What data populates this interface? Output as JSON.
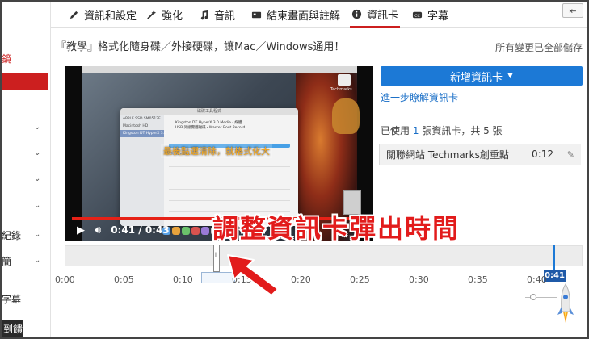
{
  "sidebar": {
    "fragments": [
      {
        "text": "鏡",
        "red": true
      },
      {
        "text": "紀錄",
        "red": false
      },
      {
        "text": "簡",
        "red": false
      },
      {
        "text": "字幕",
        "red": false
      },
      {
        "text": "到饋",
        "red": false
      }
    ]
  },
  "tabs": [
    {
      "label": "資訊和設定",
      "icon": "pencil-icon"
    },
    {
      "label": "強化",
      "icon": "magic-wand-icon"
    },
    {
      "label": "音訊",
      "icon": "music-note-icon"
    },
    {
      "label": "結束畫面與註解",
      "icon": "end-screen-icon"
    },
    {
      "label": "資訊卡",
      "icon": "info-icon",
      "active": true
    },
    {
      "label": "字幕",
      "icon": "cc-icon"
    }
  ],
  "back_button": "⇤",
  "video": {
    "title": "『教學』格式化隨身碟／外接硬碟，讓Mac／Windows通用！",
    "save_status": "所有變更已全部儲存",
    "current_time": "0:41",
    "duration": "0:43",
    "progress": 0.95,
    "caption": "最後點選清除，就格式化大",
    "watermark": "Techmarks",
    "window_title": "磁碟工具程式",
    "window_sidebar": [
      "APPLE SSD SM0512F",
      "Macintosh HD",
      "Kingston DT HyperX 3.0"
    ],
    "window_info": [
      "USB 外接實體磁碟・Master Boot Record",
      "Kingston DT HyperX 3.0 Media - 媒體"
    ],
    "window_volume_name": "Techmarks"
  },
  "cards": {
    "add_button": "新增資訊卡",
    "learn_more": "進一步瞭解資訊卡",
    "usage_prefix": "已使用",
    "usage_count": "1",
    "usage_mid": "張資訊卡，共",
    "usage_max": "5",
    "usage_suffix": "張",
    "items": [
      {
        "title": "關聯網站 Techmarks創重點",
        "time": "0:12"
      }
    ]
  },
  "annotation": "調整資訊卡彈出時間",
  "timeline": {
    "ticks": [
      "0:00",
      "0:05",
      "0:10",
      "0:15",
      "0:20",
      "0:25",
      "0:30",
      "0:35",
      "0:40"
    ],
    "playhead_label": "0:41",
    "card_marker_label": "i"
  },
  "colors": {
    "accent_red": "#cc1f1f",
    "primary_blue": "#1c79d6",
    "annotation_red": "#e21b1b",
    "progress_red": "#e62117"
  }
}
